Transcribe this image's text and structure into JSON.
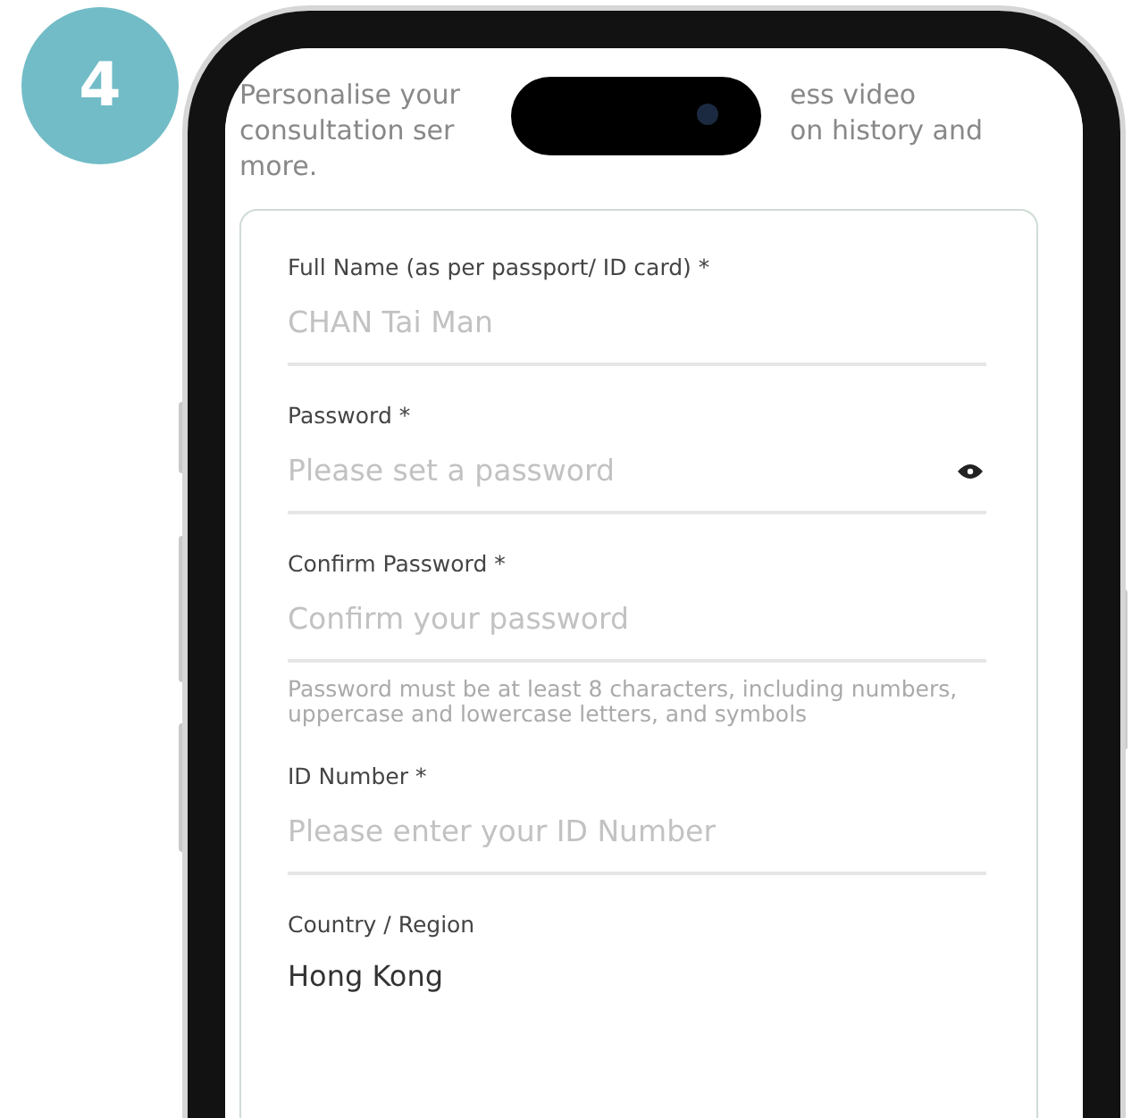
{
  "step_badge": "4",
  "intro_lines": [
    [
      "Personalise your",
      "ess video"
    ],
    [
      "consultation ser",
      "on history and"
    ],
    [
      "more."
    ]
  ],
  "fields": [
    {
      "kind": "input",
      "label": "Full Name (as per passport/ ID card) *",
      "placeholder": "CHAN Tai Man"
    },
    {
      "kind": "password",
      "label": "Password *",
      "placeholder": "Please set a password"
    },
    {
      "kind": "input",
      "label": "Confirm Password *",
      "placeholder": "Confirm your password"
    },
    {
      "kind": "note",
      "text": "Password must be at least 8 characters, including numbers, uppercase and lowercase letters, and symbols"
    },
    {
      "kind": "input",
      "label": "ID Number *",
      "placeholder": "Please enter your ID Number"
    },
    {
      "kind": "value",
      "label": "Country / Region",
      "value": "Hong Kong"
    }
  ]
}
